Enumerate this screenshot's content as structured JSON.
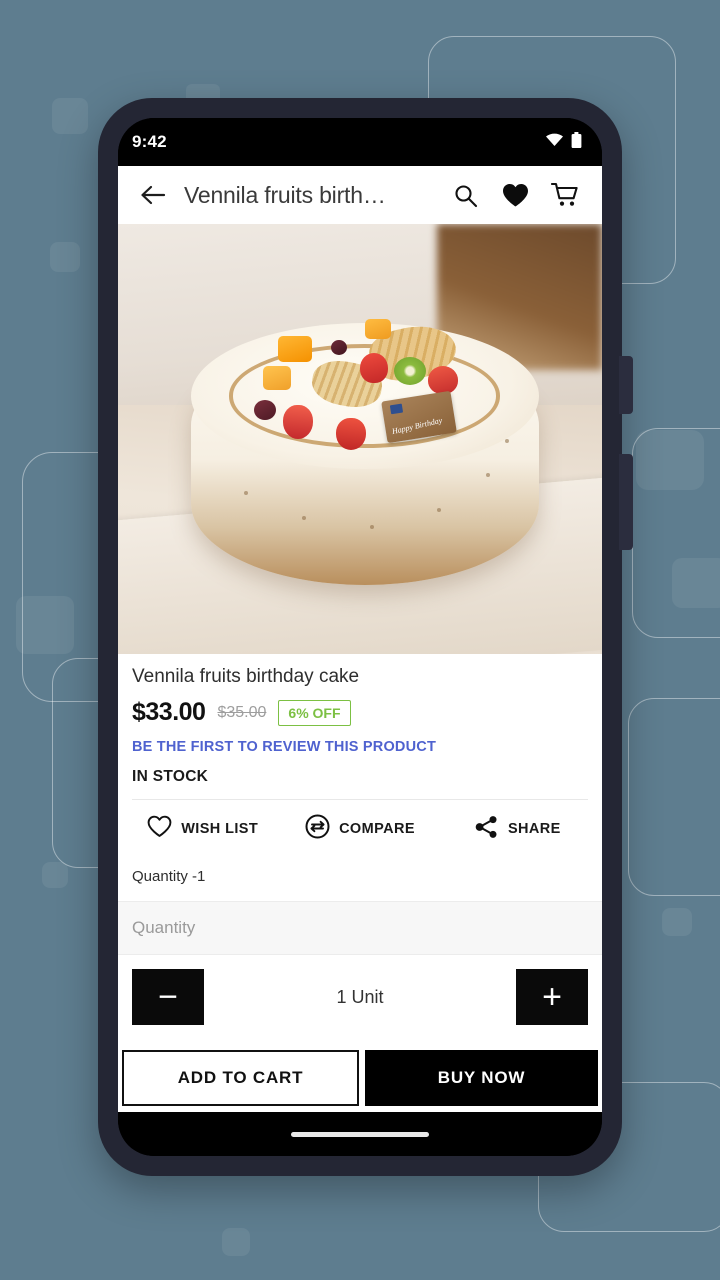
{
  "background": {
    "color": "#5e7d8f",
    "decorations": [
      "rounded-rect-outline",
      "filled-square"
    ]
  },
  "phone": {
    "bezel_color": "#242634",
    "buttons": [
      "volume-rocker",
      "power-button"
    ]
  },
  "status_bar": {
    "time": "9:42",
    "icons": [
      "wifi-icon",
      "battery-icon"
    ],
    "background": "#000000"
  },
  "app_bar": {
    "back_icon": "arrow-left-icon",
    "title": "Vennila fruits birth…",
    "actions": [
      {
        "name": "search-icon",
        "label": "Search"
      },
      {
        "name": "wishlist-heart-icon",
        "label": "Wishlist"
      },
      {
        "name": "shopping-cart-icon",
        "label": "Cart"
      }
    ]
  },
  "product": {
    "image_alt": "Vennila fruits birthday cake",
    "image_caption": "Happy Birthday",
    "name": "Vennila fruits birthday cake",
    "price": "$33.00",
    "old_price": "$35.00",
    "discount": "6% OFF",
    "discount_color": "#7cc043",
    "review_link": "BE THE FIRST TO REVIEW THIS PRODUCT",
    "review_link_color": "#4f62cf",
    "stock_status": "IN STOCK"
  },
  "actions": [
    {
      "icon": "heart-outline-icon",
      "label": "WISH LIST"
    },
    {
      "icon": "compare-arrows-icon",
      "label": "COMPARE"
    },
    {
      "icon": "share-icon",
      "label": "SHARE"
    }
  ],
  "quantity": {
    "note": "Quantity -1",
    "section_label": "Quantity",
    "decrement_icon": "minus-icon",
    "increment_icon": "plus-icon",
    "value": "1 Unit"
  },
  "bottom_bar": {
    "add_to_cart": "ADD TO CART",
    "buy_now": "BUY NOW"
  },
  "gesture_bar": {
    "indicator": "home-indicator"
  }
}
